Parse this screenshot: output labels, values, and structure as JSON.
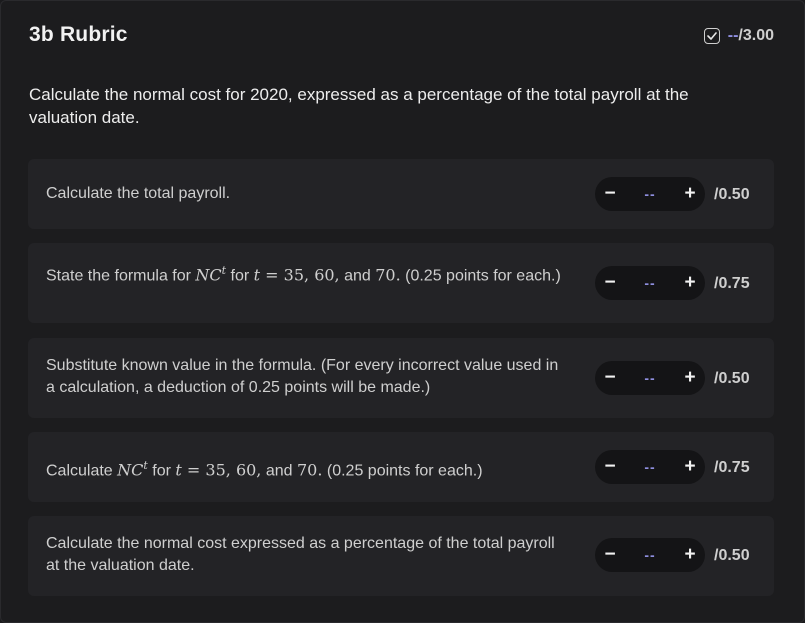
{
  "header": {
    "title": "3b Rubric",
    "score_value": "--",
    "score_max": "/3.00"
  },
  "question": "Calculate the normal cost for 2020, expressed as a percentage of the total payroll at the valuation date.",
  "items": [
    {
      "text_1": "Calculate the total payroll.",
      "value": "--",
      "max": "/0.50"
    },
    {
      "text_1": "State the formula for ",
      "math_1": "NC",
      "sup": "t",
      "text_2": " for ",
      "math_2": "t",
      "eq": " = 35, 60,",
      "text_3": " and ",
      "num": "70.",
      "text_4": " (0.25 points for each.)",
      "value": "--",
      "max": "/0.75"
    },
    {
      "text_1": "Substitute known value in the formula. (For every incorrect value used in a calculation, a deduction of 0.25 points will be made.)",
      "value": "--",
      "max": "/0.50"
    },
    {
      "text_1": "Calculate ",
      "math_1": "NC",
      "sup": "t",
      "text_2": " for ",
      "math_2": "t",
      "eq": " = 35, 60,",
      "text_3": " and ",
      "num": "70.",
      "text_4": " (0.25 points for each.)",
      "value": "--",
      "max": "/0.75"
    },
    {
      "text_1": "Calculate the normal cost expressed as a percentage of the total payroll at the valuation date.",
      "value": "--",
      "max": "/0.50"
    }
  ],
  "icons": {
    "status": "checkbox-check-icon"
  },
  "colors": {
    "background": "#1c1c1e",
    "card": "#232326",
    "stepper": "#141416",
    "accent": "#8f8fe0",
    "text": "#cfcfcf"
  }
}
